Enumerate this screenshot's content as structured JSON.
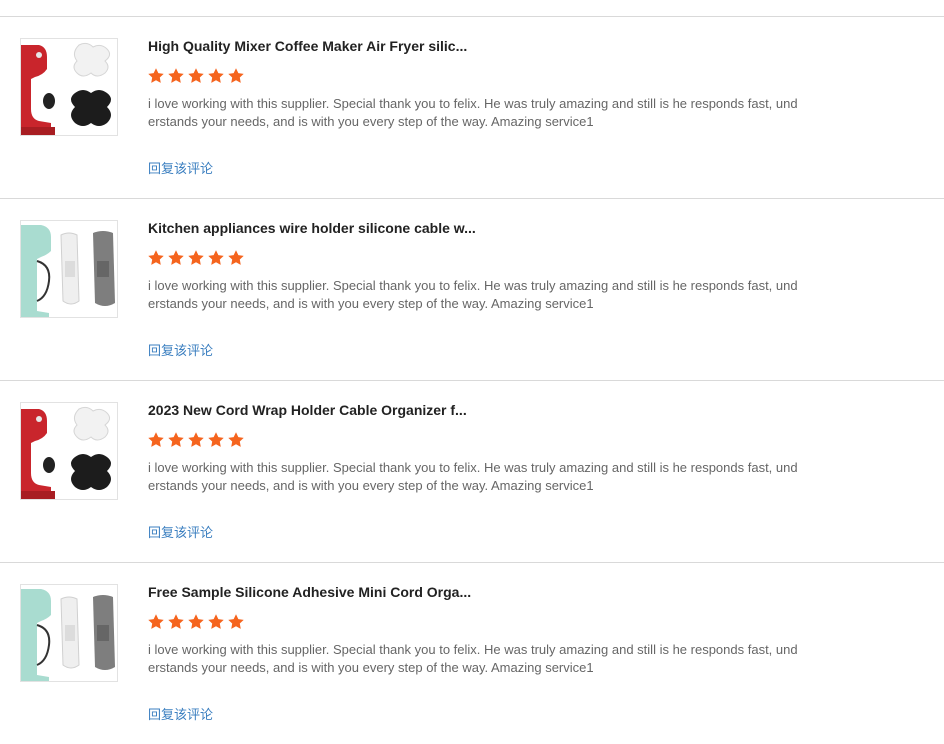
{
  "reviews": [
    {
      "title": "High Quality Mixer Coffee Maker Air Fryer silic...",
      "rating": 5,
      "comment": "i love working with this supplier. Special thank you to felix. He was truly amazing and still is he responds fast, understands your needs, and is with you every step of the way. Amazing service1",
      "reply_label": "回复该评论",
      "thumb_variant": "red-mixer"
    },
    {
      "title": "Kitchen appliances wire holder silicone cable w...",
      "rating": 5,
      "comment": "i love working with this supplier. Special thank you to felix. He was truly amazing and still is he responds fast, understands your needs, and is with you every step of the way. Amazing service1",
      "reply_label": "回复该评论",
      "thumb_variant": "mint-mixer"
    },
    {
      "title": "2023 New Cord Wrap Holder Cable Organizer f...",
      "rating": 5,
      "comment": "i love working with this supplier. Special thank you to felix. He was truly amazing and still is he responds fast, understands your needs, and is with you every step of the way. Amazing service1",
      "reply_label": "回复该评论",
      "thumb_variant": "red-mixer"
    },
    {
      "title": "Free Sample Silicone Adhesive Mini Cord Orga...",
      "rating": 5,
      "comment": "i love working with this supplier. Special thank you to felix. He was truly amazing and still is he responds fast, understands your needs, and is with you every step of the way. Amazing service1",
      "reply_label": "回复该评论",
      "thumb_variant": "mint-mixer"
    }
  ],
  "colors": {
    "star": "#f5641e",
    "link": "#3b7fc0",
    "divider": "#d9d9d9"
  }
}
